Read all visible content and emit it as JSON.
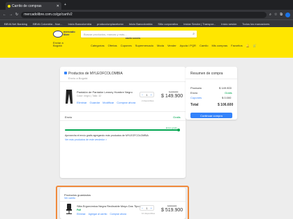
{
  "browser": {
    "tab_title": "Carrito de compras",
    "url": "mercadolibre.com.co/gz/cart/v2",
    "bookmarks": [
      "BBVA Net Banking",
      "BBVA Colombia - Nue...",
      "Inicio Bancolombia",
      "produccionplacetomx",
      "Inicio Bancolombia",
      "Sitio corporativo",
      "",
      "",
      "Iniciar Sesión | Transpor...",
      "Inicio sesión",
      "Todos los marcadores"
    ]
  },
  "header": {
    "logo_line1": "mercado",
    "logo_line2": "libre",
    "logo_line3": "ENVÍO GRATIS",
    "search_placeholder": "Buscar productos, marcas y más...",
    "address_line1": "Enviar a",
    "address_line2": "Bogotá",
    "nav": [
      "Categorías",
      "Ofertas",
      "Cupones",
      "Supermercado",
      "Moda",
      "Vender",
      "Ayuda / PQR"
    ],
    "nav_right": [
      "Camilo",
      "Mis compras",
      "Favoritos"
    ]
  },
  "cart": {
    "seller_title": "Productos de MYLEOFCOLOMBIA",
    "seller_sub": "Envío a Bogotá",
    "item": {
      "name": "Pantalón de Pantalón Lenney Hombre Negro",
      "variant": "Color: negro | Talla: 32",
      "actions": [
        "Eliminar",
        "Guardar",
        "Modificar",
        "Comprar ahora"
      ],
      "qty": "1",
      "avail": "2 disponibles",
      "old_price": "$ 179.900",
      "price": "$ 149.900"
    },
    "shipping_label": "Envío",
    "shipping_value": "Gratis",
    "progress_label": "Envío gratis",
    "progress_pct": 100,
    "promo_text": "Aprovecha el envío gratis agregando más productos de MYLEOFCOLOMBIA",
    "promo_link": "Ver más productos de este vendedor >"
  },
  "summary": {
    "title": "Resumen de compra",
    "rows": [
      {
        "label": "Producto",
        "value": "$ 149.900"
      },
      {
        "label": "Envío",
        "value": "Gratis"
      },
      {
        "label": "Cupones",
        "value": "$ 0.000"
      }
    ],
    "total_label": "Total",
    "total_value": "$ 106.600",
    "button": "Continuar compra"
  },
  "saved": {
    "title": "Productos guardados",
    "count": "Ver carrito",
    "item": {
      "name": "Silla Ergonómica Negra Reclinable Mayo Dos Tipos",
      "badge": "Full",
      "actions": [
        "Eliminar",
        "Agregar al carrito",
        "Comprar ahora"
      ],
      "qty": "1",
      "avail": "10 disponibles",
      "old_price": "$ 599.900",
      "price": "$ 519.900"
    }
  },
  "colors": {
    "brand": "#ffe600",
    "link": "#3483fa",
    "success": "#00a650",
    "highlight": "#f08a3c"
  }
}
